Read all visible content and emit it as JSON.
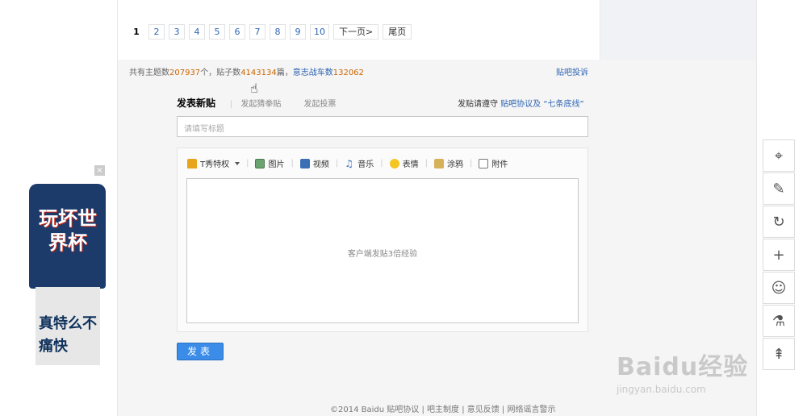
{
  "pager": {
    "pages": [
      "1",
      "2",
      "3",
      "4",
      "5",
      "6",
      "7",
      "8",
      "9",
      "10"
    ],
    "next_label": "下一页>",
    "last_label": "尾页"
  },
  "stats": {
    "topics_prefix": "共有主题数",
    "topics_count": "207937",
    "topics_suffix": "个，贴子数",
    "posts_count": "4143134",
    "posts_suffix": "篇，",
    "members_label": "意志战车数",
    "members_count": "132062"
  },
  "report_link": "贴吧投诉",
  "tabs": {
    "main": "发表新贴",
    "sub1": "发起猜拳贴",
    "sub2": "发起投票"
  },
  "rules": {
    "prefix": "发贴请遵守",
    "link": "贴吧协议及 “七条底线”"
  },
  "title_input": {
    "placeholder": "请填写标题"
  },
  "toolbar": {
    "items": [
      "T秀特权",
      "图片",
      "视频",
      "音乐",
      "表情",
      "涂鸦",
      "附件"
    ]
  },
  "editor": {
    "hint": "客户端发贴3倍经验"
  },
  "submit_label": "发表",
  "footer": {
    "copyright": "©2014 Baidu",
    "links": [
      "贴吧协议",
      "吧主制度",
      "意见反馈",
      "网络谣言警示"
    ]
  },
  "ad": {
    "close": "×",
    "shirt_text": "玩坏世界杯",
    "pants_text": "真特么不痛快"
  },
  "watermark": {
    "logo": "Baidu经验",
    "url": "jingyan.baidu.com"
  },
  "side_icons": [
    "location-icon",
    "edit-icon",
    "refresh-icon",
    "plus-icon",
    "user-manage-icon",
    "flask-icon",
    "back-to-top-icon"
  ]
}
